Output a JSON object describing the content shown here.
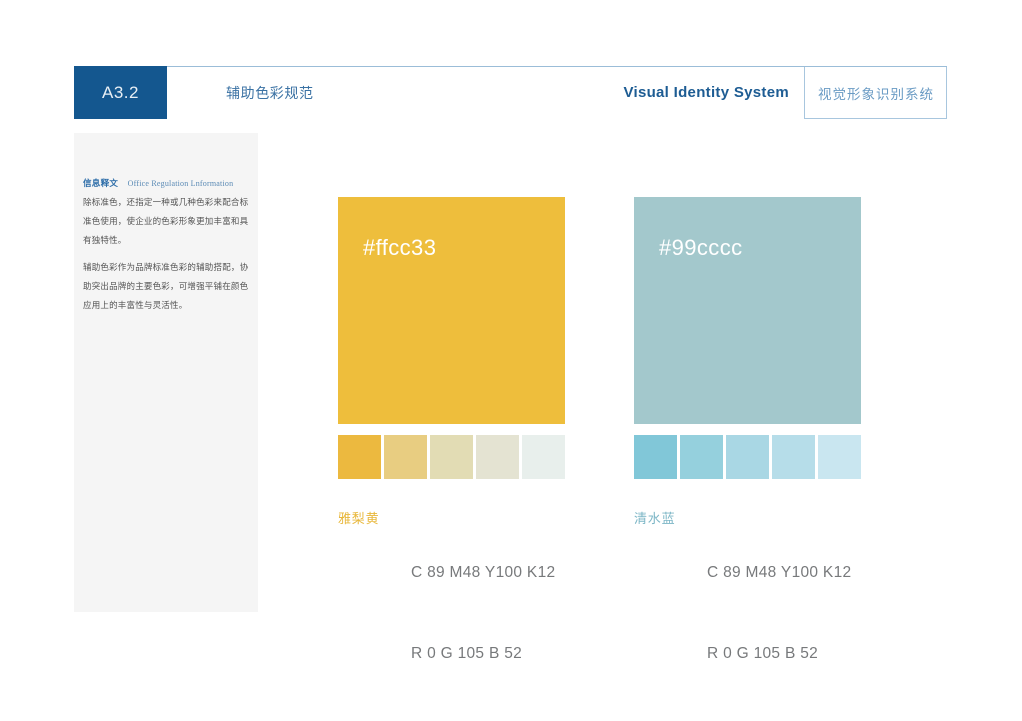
{
  "header": {
    "code": "A3.2",
    "subtitle": "辅助色彩规范",
    "system_en": "Visual Identity System",
    "system_cn": "视觉形象识别系统",
    "badge_color": "#14578f",
    "rule_color": "#9bbdd8"
  },
  "sidebar": {
    "heading_cn": "信息释文",
    "heading_en": "Office Regulation Lnformation",
    "paragraph_1": "除标准色，还指定一种或几种色彩来配合标准色使用，使企业的色彩形象更加丰富和具有独特性。",
    "paragraph_2": "辅助色彩作为品牌标准色彩的辅助搭配，协助突出品牌的主要色彩，可增强平铺在颜色应用上的丰富性与灵活性。",
    "background": "#f5f5f5"
  },
  "colors": [
    {
      "hex_label": "#ffcc33",
      "main_color": "#eebe3c",
      "name": "雅梨黄",
      "name_color": "#e8b73a",
      "cmyk": "C 89 M48  Y100  K12",
      "rgb": "R 0  G 105  B 52",
      "tints": [
        "#ecb93f",
        "#e8cd81",
        "#e2dcb4",
        "#e4e3d2",
        "#e8efec"
      ]
    },
    {
      "hex_label": "#99cccc",
      "main_color": "#a3c8cc",
      "name": "清水蓝",
      "name_color": "#7cb6c6",
      "cmyk": "C 89 M48  Y100  K12",
      "rgb": "R 0  G 105  B 52",
      "tints": [
        "#81c7d8",
        "#95d0dd",
        "#a9d7e4",
        "#b6dde9",
        "#c9e6f0"
      ]
    }
  ]
}
